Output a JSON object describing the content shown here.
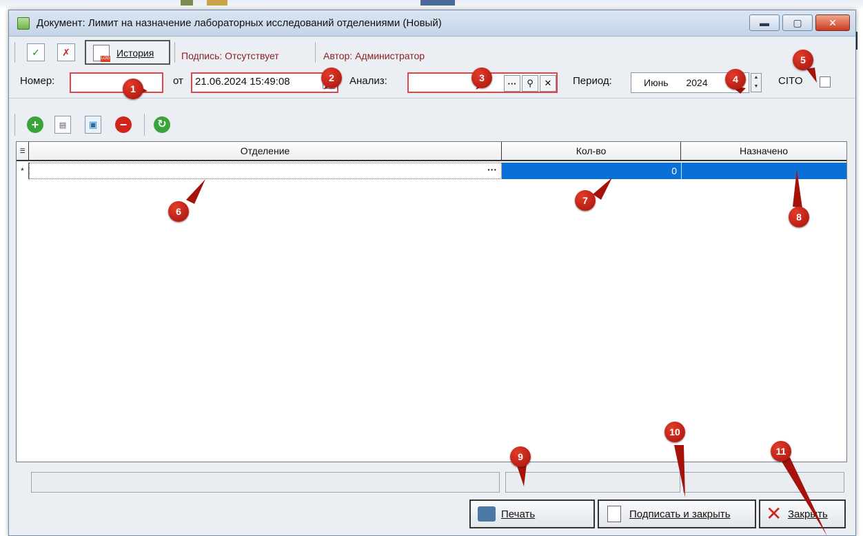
{
  "window": {
    "title": "Документ: Лимит на назначение лабораторных исследований отделениями (Новый)"
  },
  "toolbar": {
    "history_label": "История",
    "signature_text": "Подпись: Отсутствует",
    "author_text": "Автор: Администратор"
  },
  "fields": {
    "number_label": "Номер:",
    "number_value": "",
    "date_label": "от",
    "date_value": "21.06.2024 15:49:08",
    "analysis_label": "Анализ:",
    "analysis_value": "",
    "period_label": "Период:",
    "period_month": "Июнь",
    "period_year": "2024",
    "cito_label": "CITO",
    "cito_checked": false
  },
  "grid": {
    "columns": [
      "Отделение",
      "Кол-во",
      "Назначено"
    ],
    "rows": [
      {
        "marker": "*",
        "department": "",
        "qty": "0",
        "assigned": ""
      }
    ]
  },
  "buttons": {
    "print": "Печать",
    "sign_close": "Подписать и закрыть",
    "close": "Закрыть"
  },
  "markers": [
    "1",
    "2",
    "3",
    "4",
    "5",
    "6",
    "7",
    "8",
    "9",
    "10",
    "11"
  ],
  "colors": {
    "accent_selection": "#0a6fd6",
    "marker_red": "#c0160c",
    "required_border": "#e14545"
  }
}
